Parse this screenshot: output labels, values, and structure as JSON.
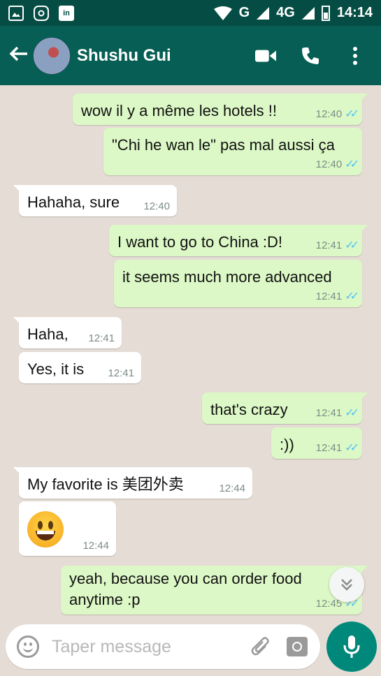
{
  "status_bar": {
    "network_label": "G",
    "network_label_2": "4G",
    "time": "14:14",
    "icons": [
      "gallery-icon",
      "instagram-icon",
      "linkedin-icon",
      "wifi-icon",
      "signal-icon",
      "battery-icon"
    ]
  },
  "header": {
    "contact_name": "Shushu Gui",
    "icons": [
      "back-arrow-icon",
      "video-call-icon",
      "phone-icon",
      "more-options-icon"
    ]
  },
  "messages": [
    {
      "dir": "out",
      "text": "wow il y a même les hotels !!",
      "time": "12:40",
      "read": true
    },
    {
      "dir": "out",
      "text": "\"Chi he wan le\" pas mal aussi ça",
      "time": "12:40",
      "read": true
    },
    {
      "dir": "in",
      "text": "Hahaha, sure",
      "time": "12:40"
    },
    {
      "dir": "out",
      "text": "I want to go to China :D!",
      "time": "12:41",
      "read": true
    },
    {
      "dir": "out",
      "text": "it seems much more advanced",
      "time": "12:41",
      "read": true
    },
    {
      "dir": "in",
      "text": "Haha,",
      "time": "12:41"
    },
    {
      "dir": "in",
      "text": "Yes, it is",
      "time": "12:41"
    },
    {
      "dir": "out",
      "text": "that's crazy",
      "time": "12:41",
      "read": true
    },
    {
      "dir": "out",
      "text": ":))",
      "time": "12:41",
      "read": true
    },
    {
      "dir": "in",
      "text": "My favorite is 美团外卖",
      "time": "12:44"
    },
    {
      "dir": "in",
      "text": "",
      "emoji": "grinning-face",
      "time": "12:44"
    },
    {
      "dir": "out",
      "text": "yeah, because you can order food",
      "text_line2": "anytime :p",
      "time": "12:45",
      "read": true
    }
  ],
  "composer": {
    "placeholder": "Taper message",
    "icons": [
      "emoji-icon",
      "attach-icon",
      "camera-icon",
      "mic-icon"
    ]
  },
  "colors": {
    "header": "#075e54",
    "status_bar": "#054d44",
    "outgoing_bubble": "#dcf8c6",
    "incoming_bubble": "#ffffff",
    "read_ticks": "#4fc3f7",
    "mic_button": "#00897b"
  }
}
